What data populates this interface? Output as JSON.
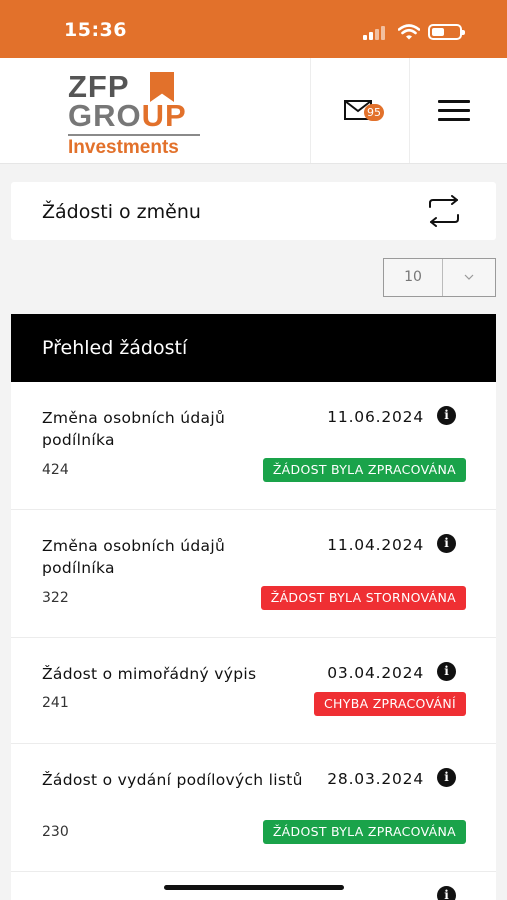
{
  "status": {
    "time": "15:36"
  },
  "brand": {
    "line1": "ZFP",
    "line2a": "GRO",
    "line2b": "UP",
    "line3": "Investments",
    "accent": "#e2712b"
  },
  "header": {
    "mail_count": "95"
  },
  "page": {
    "title": "Žádosti o změnu",
    "page_size": "10",
    "overview_title": "Přehled žádostí"
  },
  "requests": [
    {
      "name": "Změna osobních údajů podílníka",
      "date": "11.06.2024",
      "id": "424",
      "status": "ŽÁDOST BYLA ZPRACOVÁNA",
      "status_color": "#1aa34a"
    },
    {
      "name": "Změna osobních údajů podílníka",
      "date": "11.04.2024",
      "id": "322",
      "status": "ŽÁDOST BYLA STORNOVÁNA",
      "status_color": "#ef2f33"
    },
    {
      "name": "Žádost o mimořádný výpis",
      "date": "03.04.2024",
      "id": "241",
      "status": "CHYBA ZPRACOVÁNÍ",
      "status_color": "#ef2f33"
    },
    {
      "name": "Žádost o vydání podílových listů",
      "date": "28.03.2024",
      "id": "230",
      "status": "ŽÁDOST BYLA ZPRACOVÁNA",
      "status_color": "#1aa34a"
    }
  ]
}
